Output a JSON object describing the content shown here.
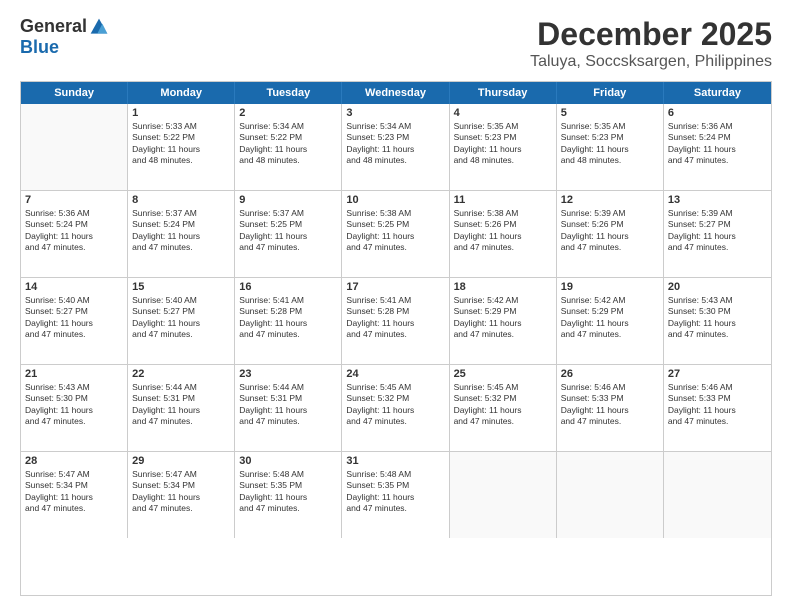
{
  "logo": {
    "general": "General",
    "blue": "Blue"
  },
  "title": "December 2025",
  "subtitle": "Taluya, Soccsksargen, Philippines",
  "days": [
    "Sunday",
    "Monday",
    "Tuesday",
    "Wednesday",
    "Thursday",
    "Friday",
    "Saturday"
  ],
  "weeks": [
    [
      {
        "day": "",
        "info": ""
      },
      {
        "day": "1",
        "info": "Sunrise: 5:33 AM\nSunset: 5:22 PM\nDaylight: 11 hours\nand 48 minutes."
      },
      {
        "day": "2",
        "info": "Sunrise: 5:34 AM\nSunset: 5:22 PM\nDaylight: 11 hours\nand 48 minutes."
      },
      {
        "day": "3",
        "info": "Sunrise: 5:34 AM\nSunset: 5:23 PM\nDaylight: 11 hours\nand 48 minutes."
      },
      {
        "day": "4",
        "info": "Sunrise: 5:35 AM\nSunset: 5:23 PM\nDaylight: 11 hours\nand 48 minutes."
      },
      {
        "day": "5",
        "info": "Sunrise: 5:35 AM\nSunset: 5:23 PM\nDaylight: 11 hours\nand 48 minutes."
      },
      {
        "day": "6",
        "info": "Sunrise: 5:36 AM\nSunset: 5:24 PM\nDaylight: 11 hours\nand 47 minutes."
      }
    ],
    [
      {
        "day": "7",
        "info": "Sunrise: 5:36 AM\nSunset: 5:24 PM\nDaylight: 11 hours\nand 47 minutes."
      },
      {
        "day": "8",
        "info": "Sunrise: 5:37 AM\nSunset: 5:24 PM\nDaylight: 11 hours\nand 47 minutes."
      },
      {
        "day": "9",
        "info": "Sunrise: 5:37 AM\nSunset: 5:25 PM\nDaylight: 11 hours\nand 47 minutes."
      },
      {
        "day": "10",
        "info": "Sunrise: 5:38 AM\nSunset: 5:25 PM\nDaylight: 11 hours\nand 47 minutes."
      },
      {
        "day": "11",
        "info": "Sunrise: 5:38 AM\nSunset: 5:26 PM\nDaylight: 11 hours\nand 47 minutes."
      },
      {
        "day": "12",
        "info": "Sunrise: 5:39 AM\nSunset: 5:26 PM\nDaylight: 11 hours\nand 47 minutes."
      },
      {
        "day": "13",
        "info": "Sunrise: 5:39 AM\nSunset: 5:27 PM\nDaylight: 11 hours\nand 47 minutes."
      }
    ],
    [
      {
        "day": "14",
        "info": "Sunrise: 5:40 AM\nSunset: 5:27 PM\nDaylight: 11 hours\nand 47 minutes."
      },
      {
        "day": "15",
        "info": "Sunrise: 5:40 AM\nSunset: 5:27 PM\nDaylight: 11 hours\nand 47 minutes."
      },
      {
        "day": "16",
        "info": "Sunrise: 5:41 AM\nSunset: 5:28 PM\nDaylight: 11 hours\nand 47 minutes."
      },
      {
        "day": "17",
        "info": "Sunrise: 5:41 AM\nSunset: 5:28 PM\nDaylight: 11 hours\nand 47 minutes."
      },
      {
        "day": "18",
        "info": "Sunrise: 5:42 AM\nSunset: 5:29 PM\nDaylight: 11 hours\nand 47 minutes."
      },
      {
        "day": "19",
        "info": "Sunrise: 5:42 AM\nSunset: 5:29 PM\nDaylight: 11 hours\nand 47 minutes."
      },
      {
        "day": "20",
        "info": "Sunrise: 5:43 AM\nSunset: 5:30 PM\nDaylight: 11 hours\nand 47 minutes."
      }
    ],
    [
      {
        "day": "21",
        "info": "Sunrise: 5:43 AM\nSunset: 5:30 PM\nDaylight: 11 hours\nand 47 minutes."
      },
      {
        "day": "22",
        "info": "Sunrise: 5:44 AM\nSunset: 5:31 PM\nDaylight: 11 hours\nand 47 minutes."
      },
      {
        "day": "23",
        "info": "Sunrise: 5:44 AM\nSunset: 5:31 PM\nDaylight: 11 hours\nand 47 minutes."
      },
      {
        "day": "24",
        "info": "Sunrise: 5:45 AM\nSunset: 5:32 PM\nDaylight: 11 hours\nand 47 minutes."
      },
      {
        "day": "25",
        "info": "Sunrise: 5:45 AM\nSunset: 5:32 PM\nDaylight: 11 hours\nand 47 minutes."
      },
      {
        "day": "26",
        "info": "Sunrise: 5:46 AM\nSunset: 5:33 PM\nDaylight: 11 hours\nand 47 minutes."
      },
      {
        "day": "27",
        "info": "Sunrise: 5:46 AM\nSunset: 5:33 PM\nDaylight: 11 hours\nand 47 minutes."
      }
    ],
    [
      {
        "day": "28",
        "info": "Sunrise: 5:47 AM\nSunset: 5:34 PM\nDaylight: 11 hours\nand 47 minutes."
      },
      {
        "day": "29",
        "info": "Sunrise: 5:47 AM\nSunset: 5:34 PM\nDaylight: 11 hours\nand 47 minutes."
      },
      {
        "day": "30",
        "info": "Sunrise: 5:48 AM\nSunset: 5:35 PM\nDaylight: 11 hours\nand 47 minutes."
      },
      {
        "day": "31",
        "info": "Sunrise: 5:48 AM\nSunset: 5:35 PM\nDaylight: 11 hours\nand 47 minutes."
      },
      {
        "day": "",
        "info": ""
      },
      {
        "day": "",
        "info": ""
      },
      {
        "day": "",
        "info": ""
      }
    ]
  ]
}
